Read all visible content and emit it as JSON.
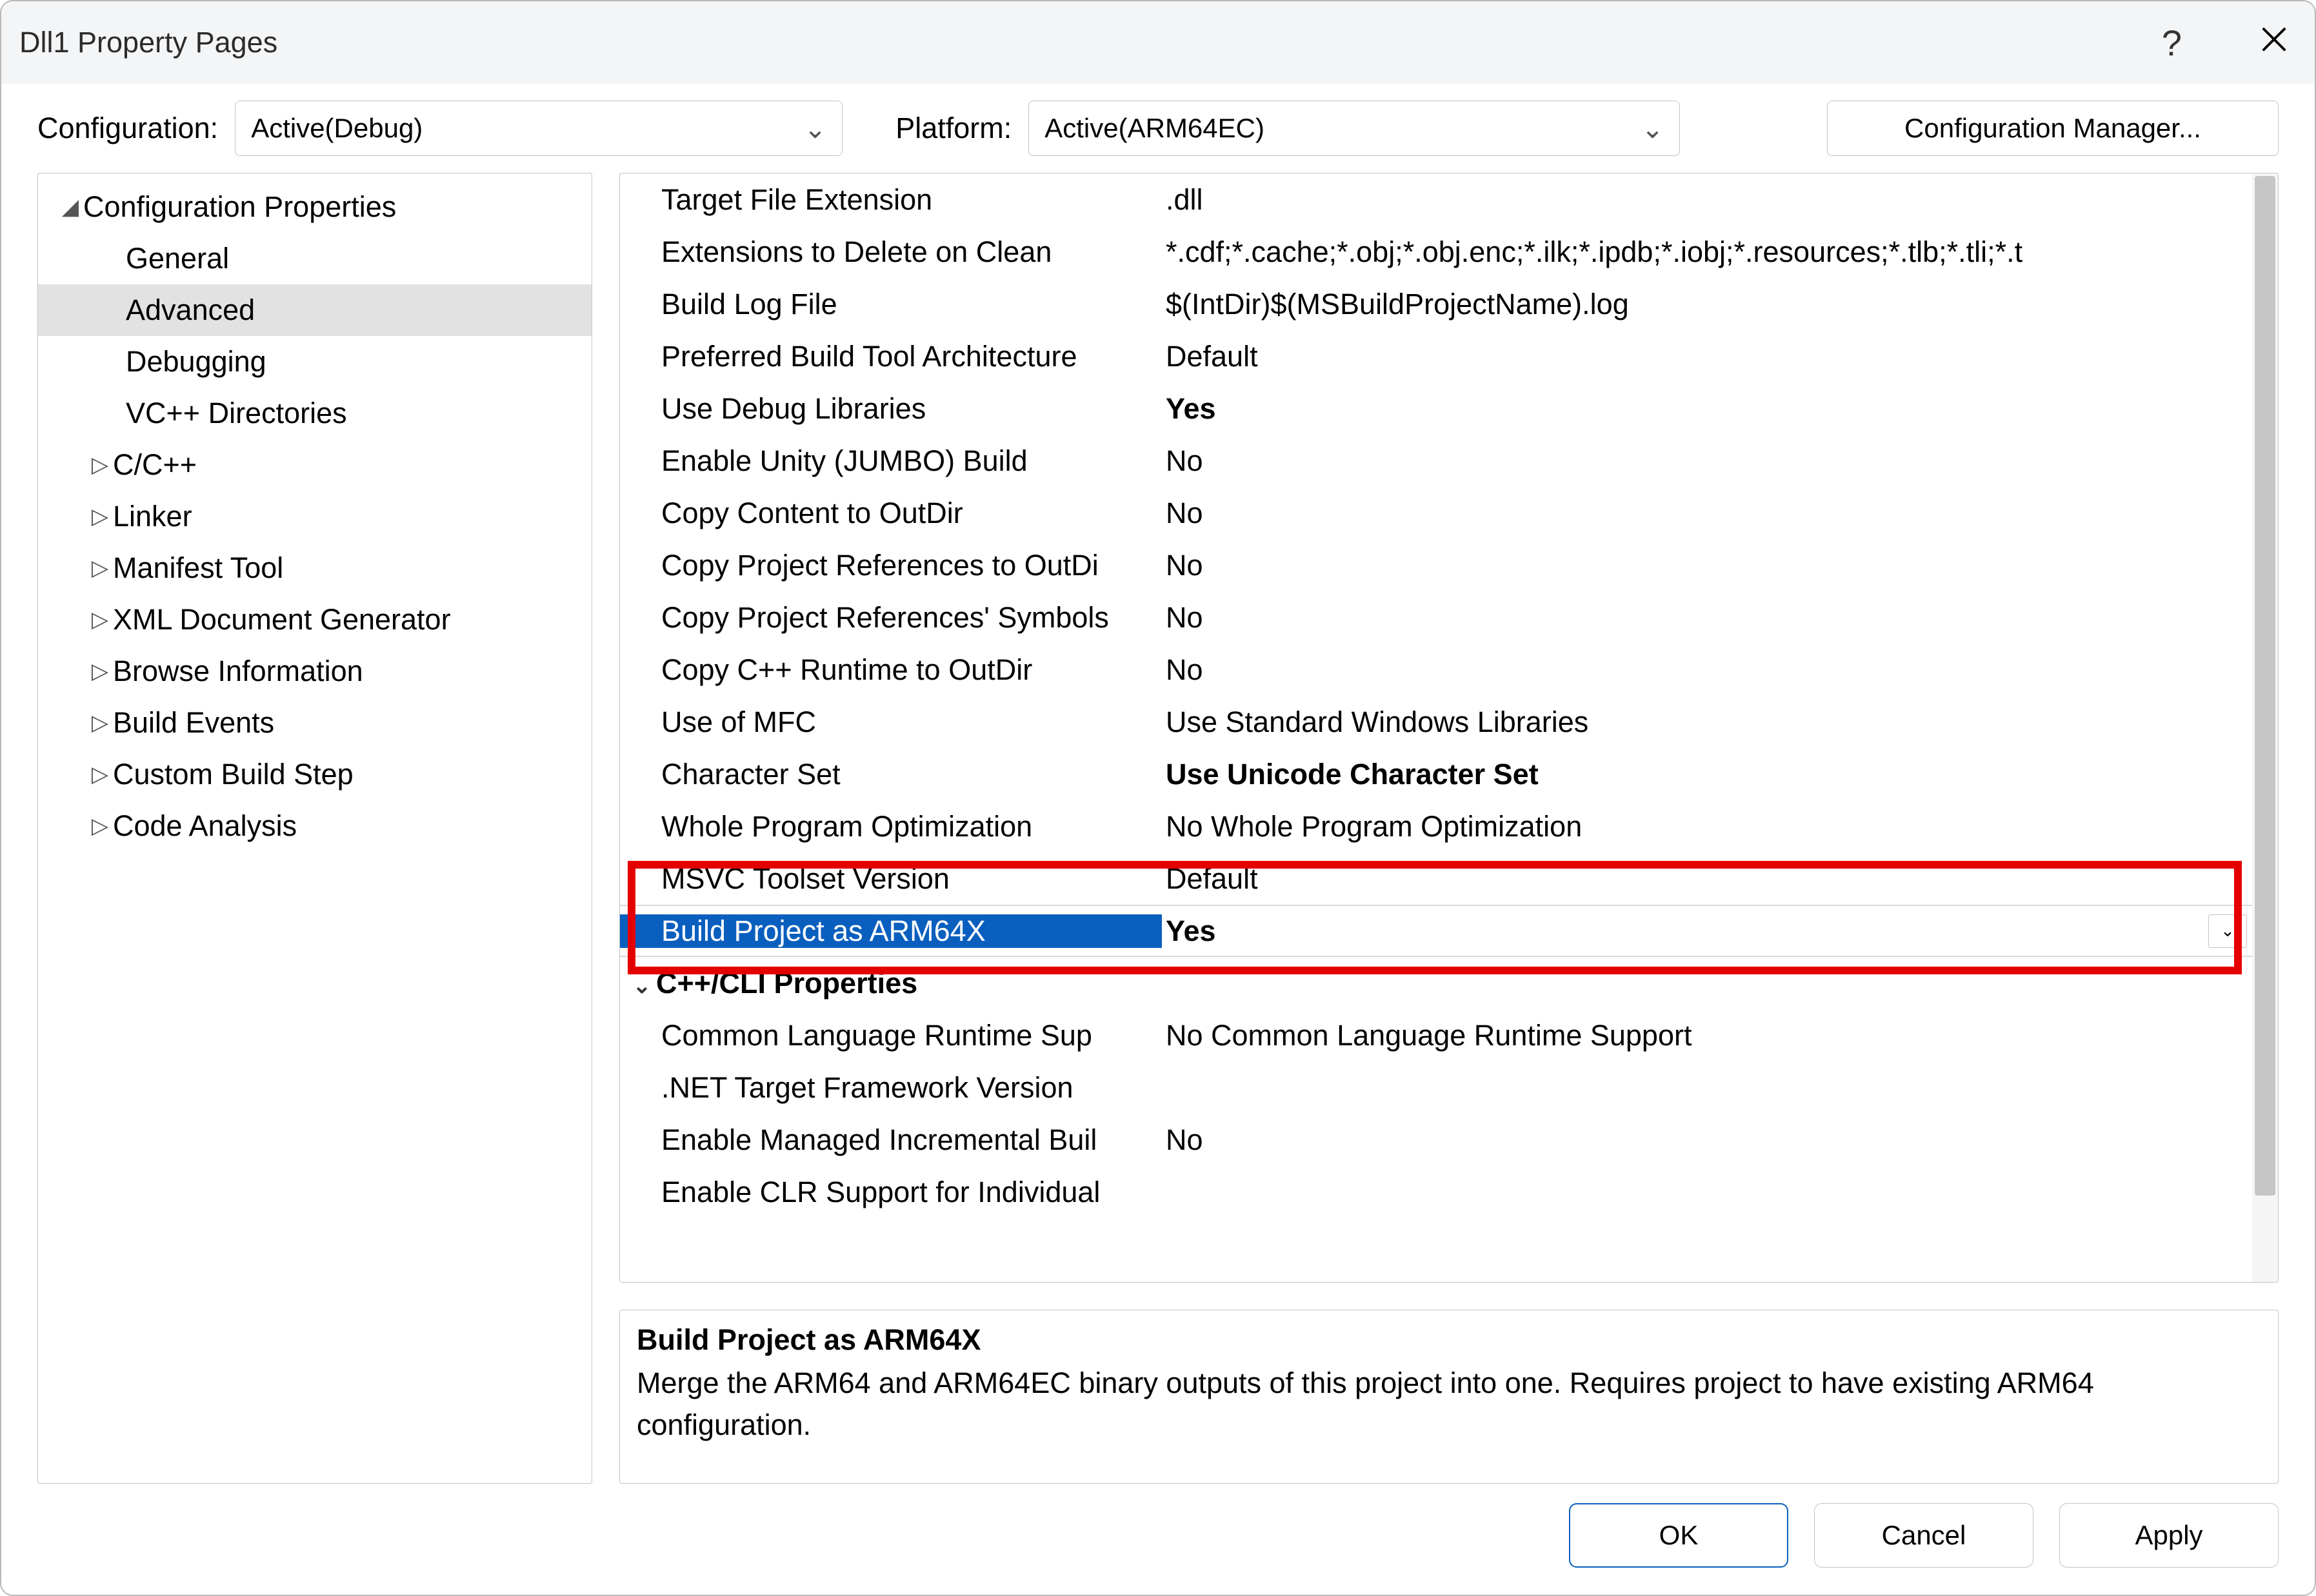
{
  "window": {
    "title": "Dll1 Property Pages"
  },
  "toprow": {
    "config_label": "Configuration:",
    "config_value": "Active(Debug)",
    "platform_label": "Platform:",
    "platform_value": "Active(ARM64EC)",
    "cfgmgr": "Configuration Manager..."
  },
  "tree": {
    "root_label": "Configuration Properties",
    "items": [
      {
        "label": "General"
      },
      {
        "label": "Advanced",
        "selected": true
      },
      {
        "label": "Debugging"
      },
      {
        "label": "VC++ Directories"
      },
      {
        "label": "C/C++",
        "expander": true
      },
      {
        "label": "Linker",
        "expander": true
      },
      {
        "label": "Manifest Tool",
        "expander": true
      },
      {
        "label": "XML Document Generator",
        "expander": true
      },
      {
        "label": "Browse Information",
        "expander": true
      },
      {
        "label": "Build Events",
        "expander": true
      },
      {
        "label": "Custom Build Step",
        "expander": true
      },
      {
        "label": "Code Analysis",
        "expander": true
      }
    ]
  },
  "props": [
    {
      "name": "Target File Extension",
      "value": ".dll"
    },
    {
      "name": "Extensions to Delete on Clean",
      "value": "*.cdf;*.cache;*.obj;*.obj.enc;*.ilk;*.ipdb;*.iobj;*.resources;*.tlb;*.tli;*.t"
    },
    {
      "name": "Build Log File",
      "value": "$(IntDir)$(MSBuildProjectName).log"
    },
    {
      "name": "Preferred Build Tool Architecture",
      "value": "Default"
    },
    {
      "name": "Use Debug Libraries",
      "value": "Yes",
      "bold": true
    },
    {
      "name": "Enable Unity (JUMBO) Build",
      "value": "No"
    },
    {
      "name": "Copy Content to OutDir",
      "value": "No"
    },
    {
      "name": "Copy Project References to OutDi",
      "value": "No"
    },
    {
      "name": "Copy Project References' Symbols",
      "value": "No"
    },
    {
      "name": "Copy C++ Runtime to OutDir",
      "value": "No"
    },
    {
      "name": "Use of MFC",
      "value": "Use Standard Windows Libraries"
    },
    {
      "name": "Character Set",
      "value": "Use Unicode Character Set",
      "bold": true
    },
    {
      "name": "Whole Program Optimization",
      "value": "No Whole Program Optimization"
    },
    {
      "name": "MSVC Toolset Version",
      "value": "Default"
    },
    {
      "name": "Build Project as ARM64X",
      "value": "Yes",
      "bold": true,
      "selected": true,
      "dropdown": true
    },
    {
      "name": "C++/CLI Properties",
      "cat": true
    },
    {
      "name": "Common Language Runtime Sup",
      "value": "No Common Language Runtime Support"
    },
    {
      "name": ".NET Target Framework Version",
      "value": ""
    },
    {
      "name": "Enable Managed Incremental Buil",
      "value": "No"
    },
    {
      "name": "Enable CLR Support for Individual",
      "value": ""
    }
  ],
  "help": {
    "title": "Build Project as ARM64X",
    "desc": "Merge the ARM64 and ARM64EC binary outputs of this project into one. Requires project to have existing ARM64 configuration."
  },
  "footer": {
    "ok": "OK",
    "cancel": "Cancel",
    "apply": "Apply"
  }
}
